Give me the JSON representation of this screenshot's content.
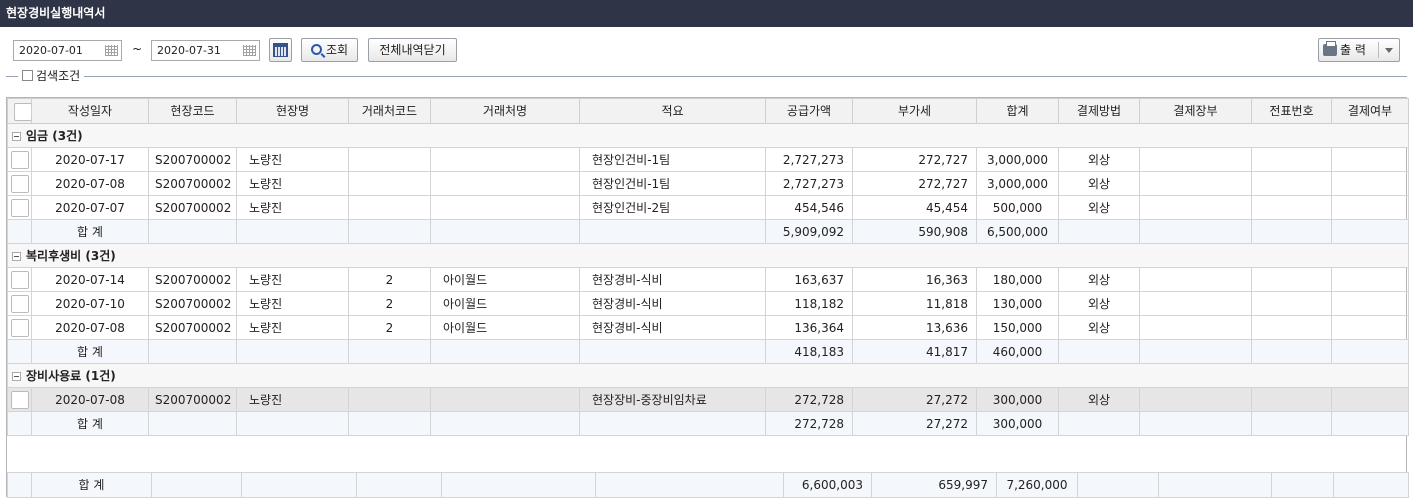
{
  "window": {
    "title": "현장경비실행내역서"
  },
  "toolbar": {
    "date_from": "2020-07-01",
    "date_to": "2020-07-31",
    "tilde": "~",
    "search_label": "조회",
    "close_all_label": "전체내역닫기",
    "print_label": "출 력"
  },
  "filter": {
    "label": "검색조건"
  },
  "columns": [
    "작성일자",
    "현장코드",
    "현장명",
    "거래처코드",
    "거래처명",
    "적요",
    "공급가액",
    "부가세",
    "합계",
    "결제방법",
    "결제장부",
    "전표번호",
    "결제여부"
  ],
  "groups": [
    {
      "title": "임금 (3건)",
      "rows": [
        {
          "date": "2020-07-17",
          "site_code": "S200700002",
          "site_name": "노량진",
          "vendor_code": "",
          "vendor_name": "",
          "memo": "현장인건비-1팀",
          "supply": "2,727,273",
          "vat": "272,727",
          "total": "3,000,000",
          "pay_method": "외상",
          "pay_book": "",
          "voucher": "",
          "paid": ""
        },
        {
          "date": "2020-07-08",
          "site_code": "S200700002",
          "site_name": "노량진",
          "vendor_code": "",
          "vendor_name": "",
          "memo": "현장인건비-1팀",
          "supply": "2,727,273",
          "vat": "272,727",
          "total": "3,000,000",
          "pay_method": "외상",
          "pay_book": "",
          "voucher": "",
          "paid": ""
        },
        {
          "date": "2020-07-07",
          "site_code": "S200700002",
          "site_name": "노량진",
          "vendor_code": "",
          "vendor_name": "",
          "memo": "현장인건비-2팀",
          "supply": "454,546",
          "vat": "45,454",
          "total": "500,000",
          "pay_method": "외상",
          "pay_book": "",
          "voucher": "",
          "paid": ""
        }
      ],
      "subtotal": {
        "label": "합 계",
        "supply": "5,909,092",
        "vat": "590,908",
        "total": "6,500,000"
      }
    },
    {
      "title": "복리후생비 (3건)",
      "rows": [
        {
          "date": "2020-07-14",
          "site_code": "S200700002",
          "site_name": "노량진",
          "vendor_code": "2",
          "vendor_name": "아이월드",
          "memo": "현장경비-식비",
          "supply": "163,637",
          "vat": "16,363",
          "total": "180,000",
          "pay_method": "외상",
          "pay_book": "",
          "voucher": "",
          "paid": ""
        },
        {
          "date": "2020-07-10",
          "site_code": "S200700002",
          "site_name": "노량진",
          "vendor_code": "2",
          "vendor_name": "아이월드",
          "memo": "현장경비-식비",
          "supply": "118,182",
          "vat": "11,818",
          "total": "130,000",
          "pay_method": "외상",
          "pay_book": "",
          "voucher": "",
          "paid": ""
        },
        {
          "date": "2020-07-08",
          "site_code": "S200700002",
          "site_name": "노량진",
          "vendor_code": "2",
          "vendor_name": "아이월드",
          "memo": "현장경비-식비",
          "supply": "136,364",
          "vat": "13,636",
          "total": "150,000",
          "pay_method": "외상",
          "pay_book": "",
          "voucher": "",
          "paid": ""
        }
      ],
      "subtotal": {
        "label": "합 계",
        "supply": "418,183",
        "vat": "41,817",
        "total": "460,000"
      }
    },
    {
      "title": "장비사용료 (1건)",
      "rows": [
        {
          "date": "2020-07-08",
          "site_code": "S200700002",
          "site_name": "노량진",
          "vendor_code": "",
          "vendor_name": "",
          "memo": "현장장비-중장비임차료",
          "supply": "272,728",
          "vat": "27,272",
          "total": "300,000",
          "pay_method": "외상",
          "pay_book": "",
          "voucher": "",
          "paid": "",
          "selected": true
        }
      ],
      "subtotal": {
        "label": "합 계",
        "supply": "272,728",
        "vat": "27,272",
        "total": "300,000"
      }
    }
  ],
  "grand_total": {
    "label": "합 계",
    "supply": "6,600,003",
    "vat": "659,997",
    "total": "7,260,000"
  }
}
